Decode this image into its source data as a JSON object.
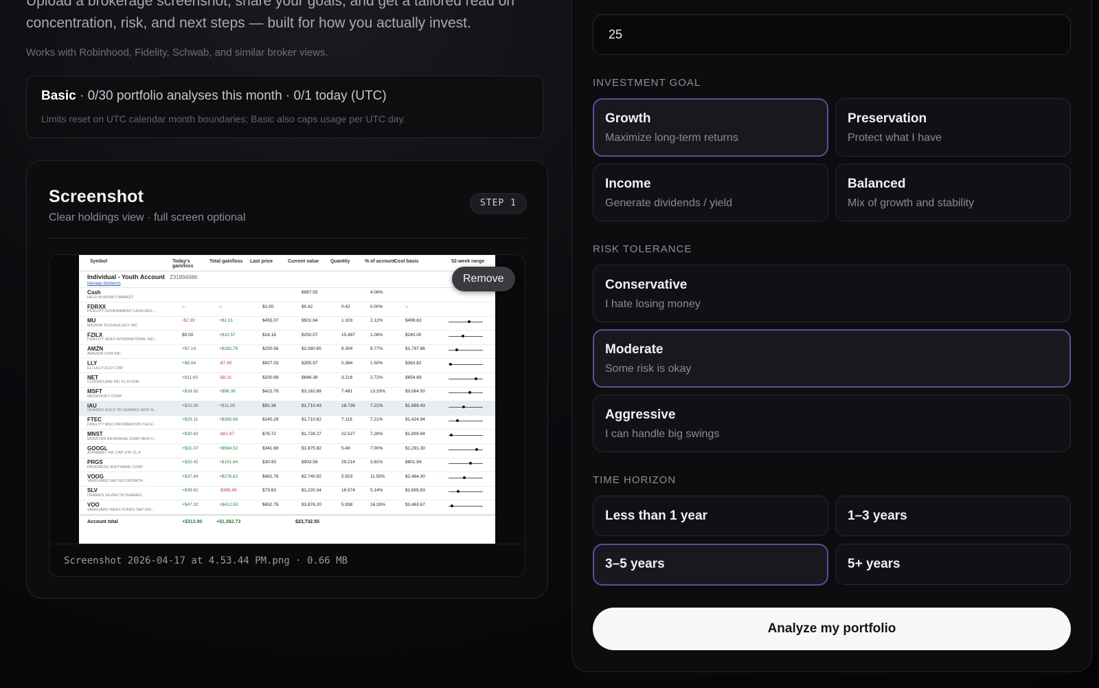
{
  "intro": {
    "text": "Upload a brokerage screenshot, share your goals, and get a tailored read on concentration, risk, and next steps — built for how you actually invest.",
    "works_with": "Works with Robinhood, Fidelity, Schwab, and similar broker views."
  },
  "plan": {
    "name": "Basic",
    "usage": " · 0/30 portfolio analyses this month · 0/1 today (UTC)",
    "note": "Limits reset on UTC calendar month boundaries; Basic also caps usage per UTC day."
  },
  "screenshot": {
    "title": "Screenshot",
    "subtitle": "Clear holdings view · full screen optional",
    "step": "STEP 1",
    "remove_label": "Remove",
    "file_line": "Screenshot 2026-04-17 at 4.53.44 PM.png · 0.66 MB",
    "preview": {
      "headers": [
        "Symbol",
        "Today's gain/loss",
        "Total gain/loss",
        "Last price",
        "Current value",
        "Quantity",
        "% of account",
        "Cost basis",
        "52-week range"
      ],
      "account_name": "Individual - Youth Account",
      "account_number": "Z31894986",
      "account_link": "Manage dividends",
      "rows": [
        {
          "sym": "Cash",
          "desc": "HELD IN MONEY MARKET",
          "today": "",
          "total": "",
          "last": "",
          "value": "$967.55",
          "qty": "",
          "pct": "4.08%",
          "cost": ""
        },
        {
          "sym": "FDRXX",
          "desc": "FIDELITY GOVERNMENT CASH RES...",
          "today": "--",
          "total": "--",
          "last": "$1.00",
          "value": "$0.42",
          "qty": "0.42",
          "pct": "0.00%",
          "cost": "--"
        },
        {
          "sym": "MU",
          "desc": "MICRON TECHNOLOGY INC",
          "today": "-$2.39",
          "total": "+$2.31",
          "last": "$455.07",
          "value": "$501.94",
          "qty": "1.103",
          "pct": "2.12%",
          "cost": "$499.63"
        },
        {
          "sym": "FZILX",
          "desc": "FIDELITY ZERO INTERNATIONAL IND...",
          "today": "$0.00",
          "total": "+$10.57",
          "last": "$16.18",
          "value": "$250.57",
          "qty": "15.487",
          "pct": "1.06%",
          "cost": "$240.00"
        },
        {
          "sym": "AMZN",
          "desc": "AMAZON COM INC",
          "today": "+$7.14",
          "total": "+$282.79",
          "last": "$250.56",
          "value": "$2,080.65",
          "qty": "8.304",
          "pct": "8.77%",
          "cost": "$1,797.86"
        },
        {
          "sym": "LLY",
          "desc": "ELI LILLY &CO COM",
          "today": "+$8.84",
          "total": "-$7.85",
          "last": "$927.03",
          "value": "$355.97",
          "qty": "0.384",
          "pct": "1.50%",
          "cost": "$363.82"
        },
        {
          "sym": "NET",
          "desc": "CLOUDFLARE INC CL A COM",
          "today": "+$11.60",
          "total": "-$8.31",
          "last": "$200.99",
          "value": "$646.38",
          "qty": "3.216",
          "pct": "2.72%",
          "cost": "$654.69"
        },
        {
          "sym": "MSFT",
          "desc": "MICROSOFT CORP",
          "today": "+$18.92",
          "total": "+$98.39",
          "last": "$422.79",
          "value": "$3,162.89",
          "qty": "7.481",
          "pct": "13.33%",
          "cost": "$3,064.50"
        },
        {
          "sym": "IAU",
          "desc": "ISHARES GOLD TR ISHARES NEW IS...",
          "today": "+$22.09",
          "total": "+$11.00",
          "last": "$91.34",
          "value": "$1,710.43",
          "qty": "18.726",
          "pct": "7.21%",
          "cost": "$1,699.43"
        },
        {
          "sym": "FTEC",
          "desc": "FIDELITY MSCI INFORMATION TECH...",
          "today": "+$29.11",
          "total": "+$285.68",
          "last": "$240.29",
          "value": "$1,710.62",
          "qty": "7.119",
          "pct": "7.21%",
          "cost": "$1,424.94"
        },
        {
          "sym": "MNST",
          "desc": "MONSTER BEVERAGE CORP NEW C...",
          "today": "+$30.63",
          "total": "-$81.67",
          "last": "$76.72",
          "value": "$1,728.27",
          "qty": "22.527",
          "pct": "7.28%",
          "cost": "$1,809.94"
        },
        {
          "sym": "GOOGL",
          "desc": "ALPHABET INC CAP STK CL A",
          "today": "+$31.07",
          "total": "+$584.52",
          "last": "$341.68",
          "value": "$1,875.82",
          "qty": "5.49",
          "pct": "7.90%",
          "cost": "$1,291.30"
        },
        {
          "sym": "PRGS",
          "desc": "PROGRESS SOFTWARE CORP",
          "today": "+$32.42",
          "total": "+$101.64",
          "last": "$30.93",
          "value": "$903.58",
          "qty": "29.214",
          "pct": "3.81%",
          "cost": "$801.94"
        },
        {
          "sym": "VOOG",
          "desc": "VANGUARD S&P 500 GROWTH...",
          "today": "+$37.84",
          "total": "+$276.62",
          "last": "$462.76",
          "value": "$2,740.92",
          "qty": "5.923",
          "pct": "11.55%",
          "cost": "$2,464.30"
        },
        {
          "sym": "SLV",
          "desc": "ISHARES SILVER TR ISHARES",
          "today": "+$39.61",
          "total": "-$385.49",
          "last": "$73.63",
          "value": "$1,220.34",
          "qty": "16.574",
          "pct": "5.14%",
          "cost": "$1,605.83"
        },
        {
          "sym": "VOO",
          "desc": "VANGUARD INDEX FUNDS S&P 500...",
          "today": "+$47.02",
          "total": "+$412.53",
          "last": "$652.78",
          "value": "$3,876.20",
          "qty": "5.938",
          "pct": "16.33%",
          "cost": "$3,463.67"
        }
      ],
      "total_label": "Account total",
      "total_today": "+$313.90",
      "total_total": "+$1,582.73",
      "total_value": "$23,732.55"
    }
  },
  "age": {
    "value": "25"
  },
  "goal": {
    "label": "INVESTMENT GOAL",
    "options": [
      {
        "title": "Growth",
        "desc": "Maximize long-term returns"
      },
      {
        "title": "Preservation",
        "desc": "Protect what I have"
      },
      {
        "title": "Income",
        "desc": "Generate dividends / yield"
      },
      {
        "title": "Balanced",
        "desc": "Mix of growth and stability"
      }
    ]
  },
  "risk": {
    "label": "RISK TOLERANCE",
    "options": [
      {
        "title": "Conservative",
        "desc": "I hate losing money"
      },
      {
        "title": "Moderate",
        "desc": "Some risk is okay"
      },
      {
        "title": "Aggressive",
        "desc": "I can handle big swings"
      }
    ]
  },
  "horizon": {
    "label": "TIME HORIZON",
    "options": [
      {
        "title": "Less than 1 year"
      },
      {
        "title": "1–3 years"
      },
      {
        "title": "3–5 years"
      },
      {
        "title": "5+ years"
      }
    ]
  },
  "analyze_label": "Analyze my portfolio",
  "colors": {
    "accent_border": "#5a4f9a",
    "background": "#0d0d10",
    "primary_button": "#f7f7f8"
  }
}
